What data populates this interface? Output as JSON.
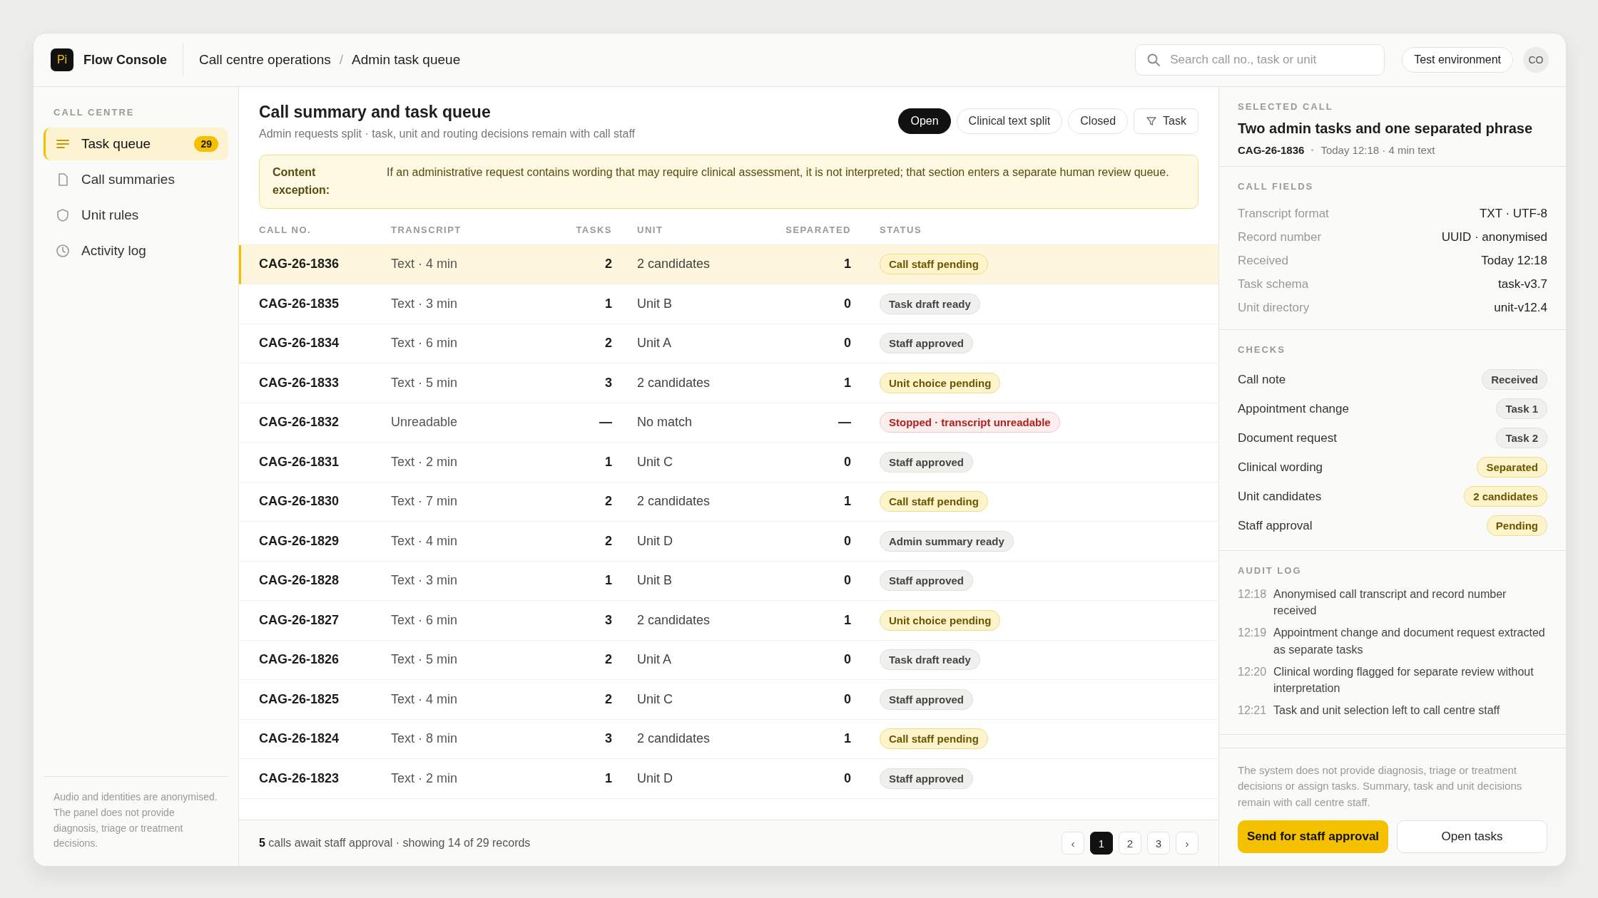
{
  "app": {
    "logo": "Pi",
    "name": "Flow Console"
  },
  "breadcrumb": [
    "Call centre operations",
    "Admin task queue"
  ],
  "breadcrumb_separator": "/",
  "search": {
    "placeholder": "Search call no., task or unit"
  },
  "environment": "Test environment",
  "user": {
    "initials": "CO"
  },
  "sidebar": {
    "heading": "CALL CENTRE",
    "items": [
      {
        "label": "Task queue",
        "count": "29",
        "selected": true
      },
      {
        "label": "Call summaries",
        "selected": false
      },
      {
        "label": "Unit rules",
        "selected": false
      },
      {
        "label": "Activity log",
        "selected": false
      }
    ],
    "note": "Audio and identities are anonymised. The panel does not provide diagnosis, triage or treatment decisions."
  },
  "main": {
    "title": "Call summary and task queue",
    "subtitle": "Admin requests split · task, unit and routing decisions remain with call staff",
    "filters": [
      {
        "label": "Open",
        "selected": true,
        "kind": "chip"
      },
      {
        "label": "Clinical text split",
        "selected": false,
        "kind": "chip"
      },
      {
        "label": "Closed",
        "selected": false,
        "kind": "chip"
      },
      {
        "label": "Task",
        "selected": false,
        "kind": "filter"
      }
    ],
    "notice": {
      "label": "Content exception:",
      "text": "If an administrative request contains wording that may require clinical assessment, it is not interpreted; that section enters a separate human review queue."
    }
  },
  "table": {
    "columns": [
      "CALL NO.",
      "TRANSCRIPT",
      "TASKS",
      "UNIT",
      "SEPARATED",
      "STATUS"
    ],
    "rows": [
      {
        "call": "CAG-26-1836",
        "transcript": "Text · 4 min",
        "tasks": "2",
        "unit": "2 candidates",
        "separated": "1",
        "status": "Call staff pending",
        "kind": "pending",
        "selected": true
      },
      {
        "call": "CAG-26-1835",
        "transcript": "Text · 3 min",
        "tasks": "1",
        "unit": "Unit B",
        "separated": "0",
        "status": "Task draft ready",
        "kind": "draft",
        "selected": false
      },
      {
        "call": "CAG-26-1834",
        "transcript": "Text · 6 min",
        "tasks": "2",
        "unit": "Unit A",
        "separated": "0",
        "status": "Staff approved",
        "kind": "approved",
        "selected": false
      },
      {
        "call": "CAG-26-1833",
        "transcript": "Text · 5 min",
        "tasks": "3",
        "unit": "2 candidates",
        "separated": "1",
        "status": "Unit choice pending",
        "kind": "pending",
        "selected": false
      },
      {
        "call": "CAG-26-1832",
        "transcript": "Unreadable",
        "tasks": "—",
        "unit": "No match",
        "separated": "—",
        "status": "Stopped · transcript unreadable",
        "kind": "stopped",
        "selected": false
      },
      {
        "call": "CAG-26-1831",
        "transcript": "Text · 2 min",
        "tasks": "1",
        "unit": "Unit C",
        "separated": "0",
        "status": "Staff approved",
        "kind": "approved",
        "selected": false
      },
      {
        "call": "CAG-26-1830",
        "transcript": "Text · 7 min",
        "tasks": "2",
        "unit": "2 candidates",
        "separated": "1",
        "status": "Call staff pending",
        "kind": "pending",
        "selected": false
      },
      {
        "call": "CAG-26-1829",
        "transcript": "Text · 4 min",
        "tasks": "2",
        "unit": "Unit D",
        "separated": "0",
        "status": "Admin summary ready",
        "kind": "draft",
        "selected": false
      },
      {
        "call": "CAG-26-1828",
        "transcript": "Text · 3 min",
        "tasks": "1",
        "unit": "Unit B",
        "separated": "0",
        "status": "Staff approved",
        "kind": "approved",
        "selected": false
      },
      {
        "call": "CAG-26-1827",
        "transcript": "Text · 6 min",
        "tasks": "3",
        "unit": "2 candidates",
        "separated": "1",
        "status": "Unit choice pending",
        "kind": "pending",
        "selected": false
      },
      {
        "call": "CAG-26-1826",
        "transcript": "Text · 5 min",
        "tasks": "2",
        "unit": "Unit A",
        "separated": "0",
        "status": "Task draft ready",
        "kind": "draft",
        "selected": false
      },
      {
        "call": "CAG-26-1825",
        "transcript": "Text · 4 min",
        "tasks": "2",
        "unit": "Unit C",
        "separated": "0",
        "status": "Staff approved",
        "kind": "approved",
        "selected": false
      },
      {
        "call": "CAG-26-1824",
        "transcript": "Text · 8 min",
        "tasks": "3",
        "unit": "2 candidates",
        "separated": "1",
        "status": "Call staff pending",
        "kind": "pending",
        "selected": false
      },
      {
        "call": "CAG-26-1823",
        "transcript": "Text · 2 min",
        "tasks": "1",
        "unit": "Unit D",
        "separated": "0",
        "status": "Staff approved",
        "kind": "approved",
        "selected": false
      }
    ]
  },
  "footer": {
    "summary": "**5** calls await staff approval · showing 14 of 29 records",
    "prev": "‹",
    "next": "›",
    "pages": [
      {
        "label": "1",
        "selected": true
      },
      {
        "label": "2",
        "selected": false
      },
      {
        "label": "3",
        "selected": false
      }
    ]
  },
  "detail": {
    "heading": "SELECTED CALL",
    "title": "Two admin tasks and one separated phrase",
    "call": "CAG-26-1836",
    "meta": "Today 12:18 · 4 min text",
    "fields_heading": "CALL FIELDS",
    "fields": [
      {
        "label": "Transcript format",
        "value": "TXT · UTF-8"
      },
      {
        "label": "Record number",
        "value": "UUID · anonymised"
      },
      {
        "label": "Received",
        "value": "Today 12:18"
      },
      {
        "label": "Task schema",
        "value": "task-v3.7"
      },
      {
        "label": "Unit directory",
        "value": "unit-v12.4"
      }
    ],
    "checks_heading": "CHECKS",
    "checks": [
      {
        "label": "Call note",
        "value": "Received",
        "kind": "done"
      },
      {
        "label": "Appointment change",
        "value": "Task 1",
        "kind": "neutral"
      },
      {
        "label": "Document request",
        "value": "Task 2",
        "kind": "neutral"
      },
      {
        "label": "Clinical wording",
        "value": "Separated",
        "kind": "pending"
      },
      {
        "label": "Unit candidates",
        "value": "2 candidates",
        "kind": "pending"
      },
      {
        "label": "Staff approval",
        "value": "Pending",
        "kind": "pending"
      }
    ],
    "audit_heading": "AUDIT LOG",
    "audit": [
      {
        "time": "12:18",
        "text": "Anonymised call transcript and record number received"
      },
      {
        "time": "12:19",
        "text": "Appointment change and document request extracted as separate tasks"
      },
      {
        "time": "12:20",
        "text": "Clinical wording flagged for separate review without interpretation"
      },
      {
        "time": "12:21",
        "text": "Task and unit selection left to call centre staff"
      }
    ],
    "disclaimer": "The system does not provide diagnosis, triage or treatment decisions or assign tasks. Summary, task and unit decisions remain with call centre staff.",
    "buttons": [
      {
        "label": "Send for staff approval",
        "kind": "primary"
      },
      {
        "label": "Open tasks",
        "kind": "secondary"
      }
    ]
  }
}
